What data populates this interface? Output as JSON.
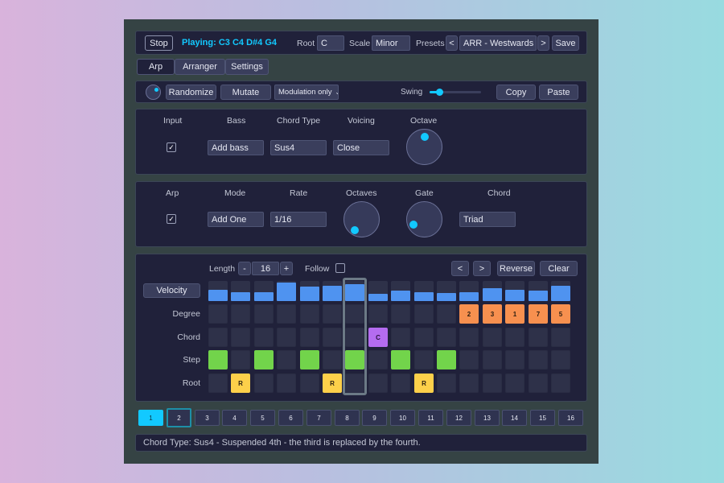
{
  "topbar": {
    "stop_label": "Stop",
    "playing": "Playing: C3 C4 D#4 G4",
    "root_label": "Root",
    "root_value": "C",
    "scale_label": "Scale",
    "scale_value": "Minor",
    "presets_label": "Presets",
    "prev_label": "<",
    "preset_value": "ARR - Westwards",
    "next_label": ">",
    "save_label": "Save"
  },
  "tabs": [
    {
      "label": "Arp",
      "active": true
    },
    {
      "label": "Arranger",
      "active": false
    },
    {
      "label": "Settings",
      "active": false
    }
  ],
  "toolbar": {
    "randomize_label": "Randomize",
    "mutate_label": "Mutate",
    "modulation_value": "Modulation only",
    "swing_label": "Swing",
    "swing_value": 0.12,
    "copy_label": "Copy",
    "paste_label": "Paste"
  },
  "chord_panel": {
    "input_label": "Input",
    "input_checked": true,
    "bass_label": "Bass",
    "bass_value": "Add bass",
    "chord_type_label": "Chord Type",
    "chord_type_value": "Sus4",
    "voicing_label": "Voicing",
    "voicing_value": "Close",
    "octave_label": "Octave"
  },
  "arp_panel": {
    "arp_label": "Arp",
    "arp_checked": true,
    "mode_label": "Mode",
    "mode_value": "Add One",
    "rate_label": "Rate",
    "rate_value": "1/16",
    "octaves_label": "Octaves",
    "gate_label": "Gate",
    "chord_label": "Chord",
    "chord_value": "Triad"
  },
  "sequencer": {
    "length_label": "Length",
    "minus_label": "-",
    "length_value": "16",
    "plus_label": "+",
    "follow_label": "Follow",
    "prev_label": "<",
    "next_label": ">",
    "reverse_label": "Reverse",
    "clear_label": "Clear",
    "velocity_label": "Velocity",
    "degree_label": "Degree",
    "chord_label": "Chord",
    "step_label": "Step",
    "root_label": "Root",
    "velocity_values": [
      0.55,
      0.45,
      0.42,
      0.9,
      0.7,
      0.75,
      0.85,
      0.35,
      0.5,
      0.45,
      0.4,
      0.45,
      0.65,
      0.55,
      0.5,
      0.75
    ],
    "degree": [
      "",
      "",
      "",
      "",
      "",
      "",
      "",
      "",
      "",
      "",
      "",
      "2",
      "3",
      "1",
      "7",
      "5"
    ],
    "chord": [
      "",
      "",
      "",
      "",
      "",
      "",
      "",
      "C",
      "",
      "",
      "",
      "",
      "",
      "",
      "",
      ""
    ],
    "step": [
      true,
      false,
      true,
      false,
      true,
      false,
      true,
      false,
      true,
      false,
      true,
      false,
      false,
      false,
      false,
      false
    ],
    "root": [
      "",
      "R",
      "",
      "",
      "",
      "R",
      "",
      "",
      "",
      "R",
      "",
      "",
      "",
      "",
      "",
      ""
    ],
    "playhead_step": 6,
    "colors": {
      "degree": "#f7904f",
      "chord": "#b46cf0",
      "step": "#72d44b",
      "root": "#fdd04a",
      "velocity": "#4f93f0"
    }
  },
  "pattern_buttons": [
    "1",
    "2",
    "3",
    "4",
    "5",
    "6",
    "7",
    "8",
    "9",
    "10",
    "11",
    "12",
    "13",
    "14",
    "15",
    "16"
  ],
  "active_pattern": 1,
  "status": "Chord Type: Sus4 - Suspended 4th - the third is replaced by the fourth.",
  "accent_color": "#12c9ff"
}
